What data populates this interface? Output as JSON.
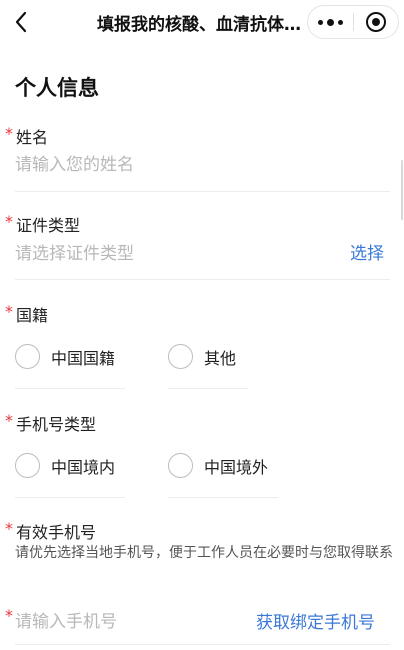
{
  "navbar": {
    "title": "填报我的核酸、血清抗体检测信息",
    "back_icon": "chevron-left-icon",
    "more_icon": "more-dots-icon",
    "close_icon": "target-circle-icon"
  },
  "section": {
    "title": "个人信息"
  },
  "form": {
    "required_mark": "*",
    "name": {
      "label": "姓名",
      "placeholder": "请输入您的姓名"
    },
    "id_type": {
      "label": "证件类型",
      "placeholder": "请选择证件类型",
      "action": "选择"
    },
    "nationality": {
      "label": "国籍",
      "options": [
        "中国国籍",
        "其他"
      ]
    },
    "phone_type": {
      "label": "手机号类型",
      "options": [
        "中国境内",
        "中国境外"
      ]
    },
    "phone": {
      "label": "有效手机号",
      "hint": "请优先选择当地手机号，便于工作人员在必要时与您取得联系",
      "placeholder": "请输入手机号",
      "action": "获取绑定手机号"
    }
  },
  "colors": {
    "required": "#e4393c",
    "link": "#3a78d8",
    "placeholder": "#b8b8b8"
  }
}
